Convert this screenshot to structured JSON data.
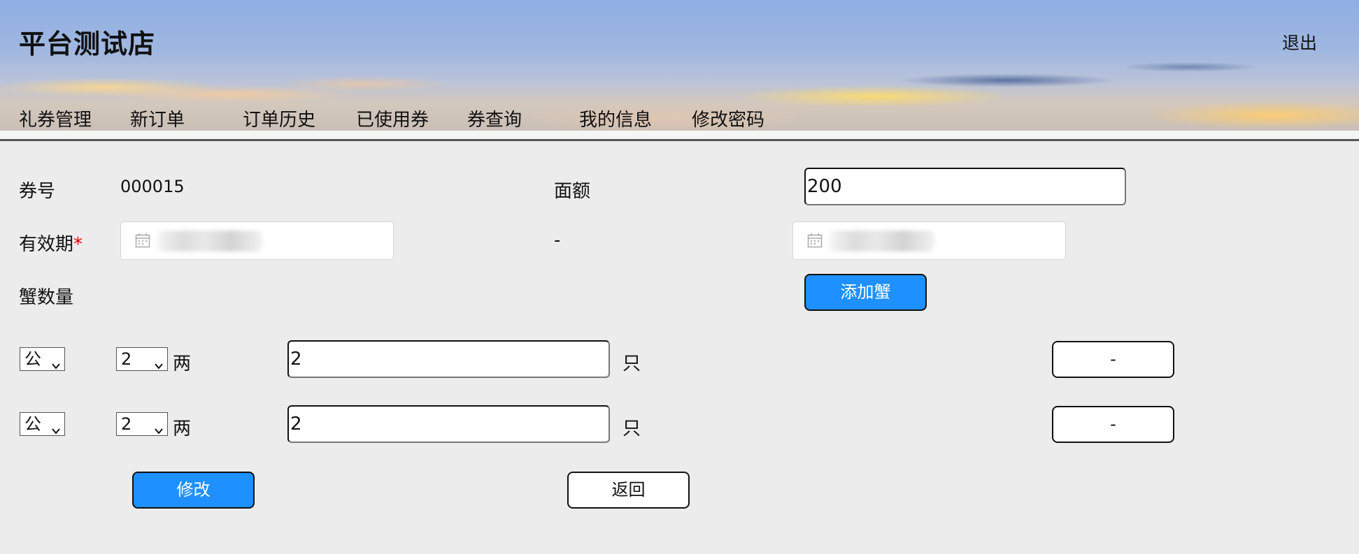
{
  "header": {
    "title": "平台测试店",
    "logout": "退出",
    "nav": [
      "礼券管理",
      "新订单",
      "订单历史",
      "已使用券",
      "券查询",
      "我的信息",
      "修改密码"
    ]
  },
  "form": {
    "voucher_no_label": "券号",
    "voucher_no": "000015",
    "face_value_label": "面额",
    "face_value": "200",
    "validity_label": "有效期",
    "required_mark": "*",
    "range_separator": "-",
    "crab_qty_label": "蟹数量",
    "add_crab": "添加蟹",
    "rows": [
      {
        "gender": "公",
        "weight": "2",
        "weight_unit": "两",
        "count": "2",
        "count_unit": "只",
        "remove": "-"
      },
      {
        "gender": "公",
        "weight": "2",
        "weight_unit": "两",
        "count": "2",
        "count_unit": "只",
        "remove": "-"
      }
    ],
    "submit": "修改",
    "back": "返回"
  },
  "colors": {
    "primary_button": "#1e90ff",
    "required": "#e00000",
    "page_background": "#ececec"
  }
}
